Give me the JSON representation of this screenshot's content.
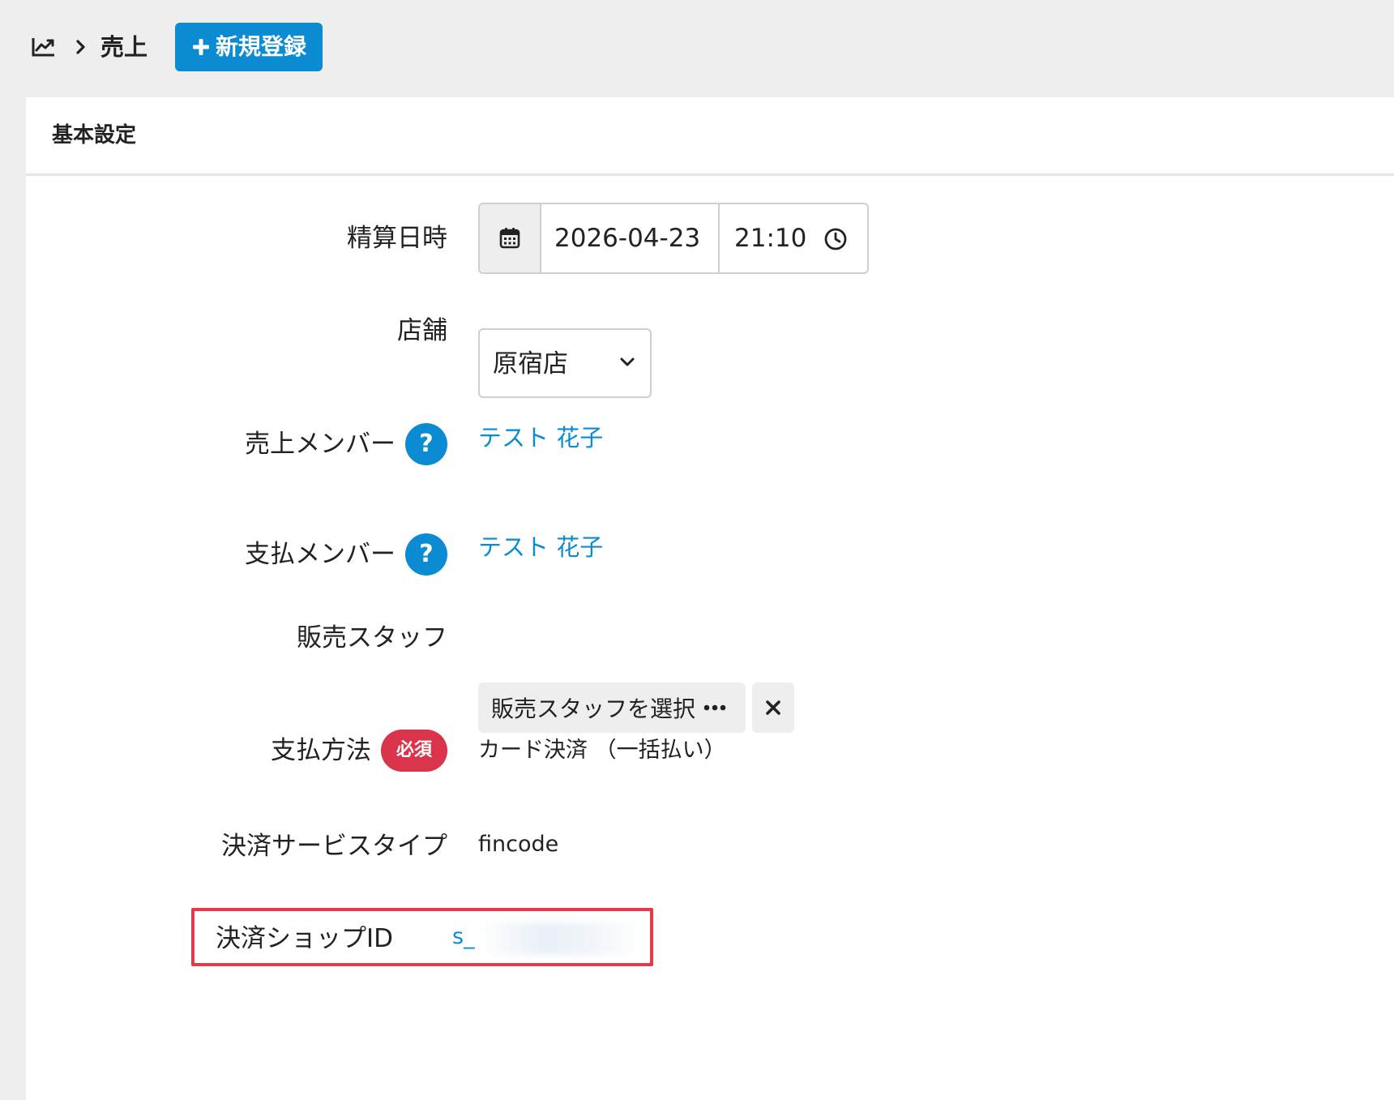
{
  "breadcrumb": {
    "section_icon": "chart-line-icon",
    "separator_icon": "chevron-right-icon",
    "current": "売上"
  },
  "new_button": {
    "icon": "plus-icon",
    "label": "新規登録"
  },
  "panel": {
    "title": "基本設定"
  },
  "form": {
    "settle_datetime": {
      "label": "精算日時",
      "date": "2026-04-23",
      "time": "21:10",
      "calendar_icon": "calendar-icon",
      "clock_icon": "clock-icon"
    },
    "store": {
      "label": "店舗",
      "value": "原宿店"
    },
    "sales_member": {
      "label": "売上メンバー",
      "help": "?",
      "value": "テスト 花子"
    },
    "payment_member": {
      "label": "支払メンバー",
      "help": "?",
      "value": "テスト 花子"
    },
    "sales_staff": {
      "label": "販売スタッフ",
      "button": "販売スタッフを選択"
    },
    "payment_method": {
      "label": "支払方法",
      "required_badge": "必須",
      "value": "カード決済 （一括払い）"
    },
    "payment_service_type": {
      "label": "決済サービスタイプ",
      "value": "fincode"
    },
    "payment_shop_id": {
      "label": "決済ショップID",
      "value": "s_"
    }
  },
  "colors": {
    "accent": "#0b8bd1",
    "required": "#d9344a",
    "highlight": "#e23b4b",
    "background": "#eeeeee"
  }
}
